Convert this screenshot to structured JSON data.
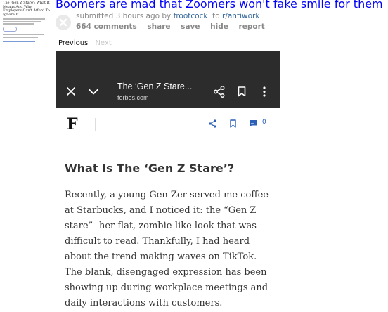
{
  "post": {
    "title": "Boomers are mad that Zoomers won't fake smile for them",
    "tagline": {
      "submitted": "submitted",
      "age": "3 hours ago",
      "by": "by",
      "author": "frootcock",
      "to": "to",
      "subreddit": "r/antiwork"
    },
    "buttons": {
      "comments": "664 comments",
      "share": "share",
      "save": "save",
      "hide": "hide",
      "report": "report"
    }
  },
  "thumbnail": {
    "title": "The 'Gen Z Stare': What It Means And Why Employers Can't Afford To Ignore It"
  },
  "gallery": {
    "previous": "Previous",
    "next": "Next"
  },
  "screenshot": {
    "browser": {
      "page_title": "The ‘Gen Z Stare...",
      "domain": "forbes.com"
    },
    "site": {
      "logo": "F",
      "comment_count": "0",
      "accent_color": "#2c5fb8"
    },
    "article": {
      "heading": "What Is The ‘Gen Z Stare’?",
      "body": "Recently, a young Gen Zer served me coffee at Starbucks, and I noticed it: the “Gen Z stare”--her flat, zombie-like look that was difficult to read. Thankfully, I had heard about the trend making waves on TikTok. The blank, disengaged expression has been showing up during workplace meetings and daily interactions with customers."
    }
  }
}
